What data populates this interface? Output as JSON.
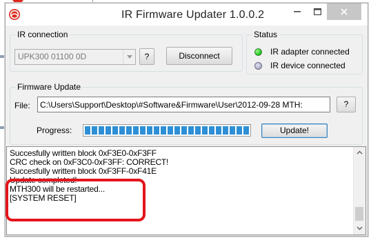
{
  "window": {
    "title": "IR Firmware Updater 1.0.0.2",
    "icons": {
      "app": "app-logo-icon",
      "minimize": "minimize-icon",
      "maximize": "maximize-icon",
      "close": "close-icon"
    }
  },
  "ir_connection": {
    "label": "IR connection",
    "device_value": "UPK300  01100 0D",
    "help_label": "?",
    "disconnect_label": "Disconnect"
  },
  "status": {
    "label": "Status",
    "items": [
      {
        "text": "IR adapter connected",
        "color": "#1ec81a"
      },
      {
        "text": "IR device connected",
        "color": "#b8b8d0"
      }
    ]
  },
  "firmware_update": {
    "label": "Firmware Update",
    "file_label": "File:",
    "file_path": "C:\\Users\\Support\\Desktop\\#Software&Firmware\\User\\2012-09-28 MTH:",
    "browse_label": "?",
    "progress_label": "Progress:",
    "progress_value": 1.0,
    "update_label": "Update!"
  },
  "log": {
    "lines": [
      "Succesfully written block 0xF3E0-0xF3FF",
      "CRC check on 0xF3C0-0xF3FF:  CORRECT!",
      "Succesfully written block 0xF3FF-0xF41E",
      "Update completed!",
      "MTH300 will be restarted...",
      "[SYSTEM RESET]"
    ]
  },
  "annotation_color": "#e3141b"
}
